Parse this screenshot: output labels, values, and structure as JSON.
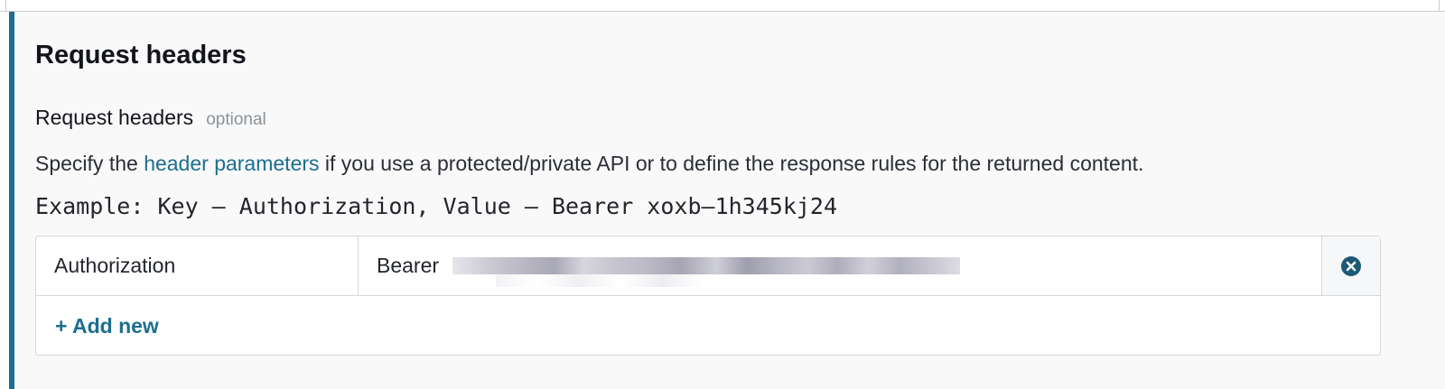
{
  "section": {
    "title": "Request headers"
  },
  "field": {
    "label": "Request headers",
    "optional": "optional",
    "description_prefix": "Specify the ",
    "description_link": "header parameters",
    "description_suffix": " if you use a protected/private API or to define the response rules for the returned content.",
    "example": "Example: Key – Authorization, Value – Bearer xoxb–1h345kj24"
  },
  "headers": [
    {
      "key": "Authorization",
      "value": "Bearer"
    }
  ],
  "actions": {
    "add_new": "+ Add new",
    "remove_icon": "close-circle-icon"
  },
  "colors": {
    "accent": "#1c6e8f",
    "border": "#d3d8dc",
    "background": "#f9f9f9"
  }
}
